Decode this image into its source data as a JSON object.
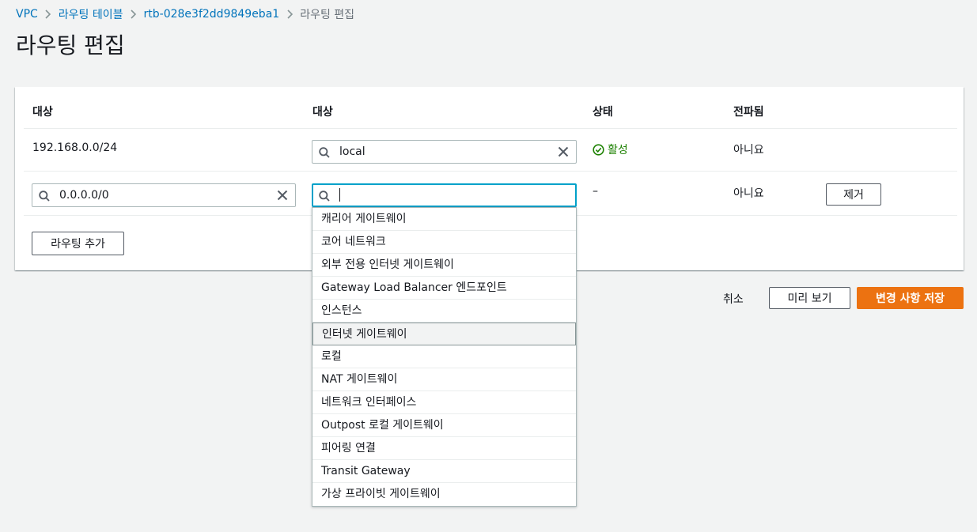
{
  "breadcrumb": {
    "items": [
      "VPC",
      "라우팅 테이블",
      "rtb-028e3f2dd9849eba1"
    ],
    "current": "라우팅 편집"
  },
  "page_title": "라우팅 편집",
  "table": {
    "columns": [
      "대상",
      "대상",
      "상태",
      "전파됨"
    ],
    "row1": {
      "destination": "192.168.0.0/24",
      "target_value": "local",
      "status": "활성",
      "propagated": "아니요"
    },
    "row2": {
      "destination_value": "0.0.0.0/0",
      "target_value": "",
      "status": "–",
      "propagated": "아니요",
      "remove_label": "제거"
    },
    "add_route_label": "라우팅 추가"
  },
  "dropdown": {
    "options": [
      "캐리어 게이트웨이",
      "코어 네트워크",
      "외부 전용 인터넷 게이트웨이",
      "Gateway Load Balancer 엔드포인트",
      "인스턴스",
      "인터넷 게이트웨이",
      "로컬",
      "NAT 게이트웨이",
      "네트워크 인터페이스",
      "Outpost 로컬 게이트웨이",
      "피어링 연결",
      "Transit Gateway",
      "가상 프라이빗 게이트웨이"
    ],
    "highlighted_index": 5
  },
  "footer": {
    "cancel_label": "취소",
    "preview_label": "미리 보기",
    "save_label": "변경 사항 저장"
  },
  "colors": {
    "link": "#0073bb",
    "primary": "#ec7211",
    "focus": "#00a1c9",
    "success": "#1d8102"
  },
  "icons": [
    "chevron-right-icon",
    "search-icon",
    "clear-icon",
    "check-circle-icon"
  ]
}
